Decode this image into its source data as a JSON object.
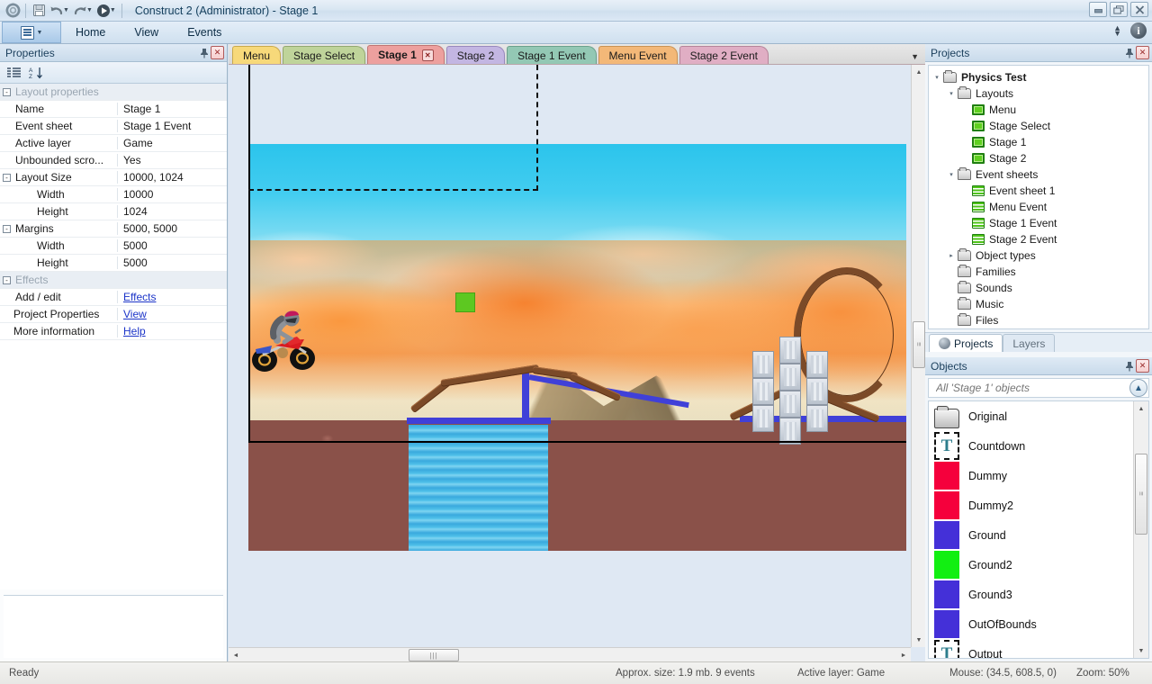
{
  "titlebar": {
    "app_icon": "construct-gear-icon",
    "title": "Construct 2 (Administrator) - Stage 1",
    "toolbar": [
      {
        "name": "save-button",
        "icon": "floppy-disk-icon"
      },
      {
        "name": "undo-button",
        "icon": "undo-arrow-icon"
      },
      {
        "name": "redo-button",
        "icon": "redo-arrow-icon"
      },
      {
        "name": "run-button",
        "icon": "play-circle-icon"
      },
      {
        "name": "quick-access-customize-button",
        "icon": "chevron-down-bar-icon"
      }
    ],
    "window_buttons": [
      {
        "name": "minimize-button",
        "glyph": "–"
      },
      {
        "name": "restore-button",
        "glyph": "❐"
      },
      {
        "name": "close-button",
        "glyph": "✕"
      }
    ]
  },
  "menubar": {
    "app_button_label": "",
    "items": [
      "Home",
      "View",
      "Events"
    ],
    "ribbon_toggle": "collapse-ribbon-icon",
    "help": "i"
  },
  "properties": {
    "panel_title": "Properties",
    "pin_glyph": "⚇",
    "close_glyph": "✕",
    "toolbar": [
      {
        "name": "categorized-view-button",
        "icon": "list-category-icon"
      },
      {
        "name": "alphabetical-sort-button",
        "icon": "sort-az-icon"
      }
    ],
    "rows": [
      {
        "type": "group",
        "expander": "-",
        "name": "Layout properties",
        "value": ""
      },
      {
        "type": "row",
        "expander": "",
        "name": "Name",
        "value": "Stage 1"
      },
      {
        "type": "row",
        "expander": "",
        "name": "Event sheet",
        "value": "Stage 1 Event"
      },
      {
        "type": "row",
        "expander": "",
        "name": "Active layer",
        "value": "Game"
      },
      {
        "type": "row",
        "expander": "",
        "name": "Unbounded scro...",
        "value": "Yes"
      },
      {
        "type": "row",
        "expander": "-",
        "name": "Layout Size",
        "value": "10000, 1024"
      },
      {
        "type": "sub",
        "expander": "",
        "name": "Width",
        "value": "10000"
      },
      {
        "type": "sub",
        "expander": "",
        "name": "Height",
        "value": "1024"
      },
      {
        "type": "row",
        "expander": "-",
        "name": "Margins",
        "value": "5000, 5000"
      },
      {
        "type": "sub",
        "expander": "",
        "name": "Width",
        "value": "5000"
      },
      {
        "type": "sub",
        "expander": "",
        "name": "Height",
        "value": "5000"
      },
      {
        "type": "group",
        "expander": "-",
        "name": "Effects",
        "value": ""
      },
      {
        "type": "row",
        "expander": "",
        "name": "Add / edit",
        "value": "Effects",
        "link": true
      },
      {
        "type": "rownoindent",
        "expander": "",
        "name": "Project Properties",
        "value": "View",
        "link": true
      },
      {
        "type": "rownoindent",
        "expander": "",
        "name": "More information",
        "value": "Help",
        "link": true
      }
    ]
  },
  "editor": {
    "tabs": [
      {
        "label": "Menu",
        "color": "#f7d97a",
        "border": "#c9a94b",
        "active": false,
        "closable": false
      },
      {
        "label": "Stage Select",
        "color": "#bfd49a",
        "border": "#92a870",
        "active": false,
        "closable": false
      },
      {
        "label": "Stage 1",
        "color": "#eda09e",
        "border": "#c07674",
        "active": true,
        "closable": true
      },
      {
        "label": "Stage 2",
        "color": "#c3b6e2",
        "border": "#9888bd",
        "active": false,
        "closable": false
      },
      {
        "label": "Stage 1 Event",
        "color": "#93c8b4",
        "border": "#6ba18c",
        "active": false,
        "closable": false
      },
      {
        "label": "Menu Event",
        "color": "#f3b878",
        "border": "#c99354",
        "active": false,
        "closable": false
      },
      {
        "label": "Stage 2 Event",
        "color": "#e0aec4",
        "border": "#b5849a",
        "active": false,
        "closable": false
      }
    ],
    "tab_dropdown_glyph": "▼",
    "close_glyph": "✕",
    "canvas": {
      "description": "Stage 1 layout - motocross physics scene",
      "objects": [
        {
          "name": "biker-sprite",
          "label": "Biker"
        },
        {
          "name": "green-square-object",
          "label": "Ground2",
          "color": "#5dc821"
        },
        {
          "name": "crate-stack",
          "label": "Crates"
        },
        {
          "name": "loop-track",
          "label": "Track loop"
        },
        {
          "name": "water-pool",
          "label": "Water"
        },
        {
          "name": "rock-ground",
          "label": "Ground"
        }
      ]
    },
    "scrollbars": {
      "left_arrow": "◄",
      "right_arrow": "►",
      "up_arrow": "▲",
      "down_arrow": "▼",
      "grip": "❘❘❘"
    }
  },
  "projects": {
    "panel_title": "Projects",
    "pin_glyph": "⚇",
    "close_glyph": "✕",
    "tree": [
      {
        "depth": 0,
        "twisty": "▾",
        "icon": "folder-icon",
        "label": "Physics Test",
        "bold": true
      },
      {
        "depth": 1,
        "twisty": "▾",
        "icon": "folder-icon",
        "label": "Layouts",
        "bold": false
      },
      {
        "depth": 2,
        "twisty": "",
        "icon": "layout-icon",
        "label": "Menu",
        "bold": false
      },
      {
        "depth": 2,
        "twisty": "",
        "icon": "layout-icon",
        "label": "Stage Select",
        "bold": false
      },
      {
        "depth": 2,
        "twisty": "",
        "icon": "layout-icon",
        "label": "Stage 1",
        "bold": false
      },
      {
        "depth": 2,
        "twisty": "",
        "icon": "layout-icon",
        "label": "Stage 2",
        "bold": false
      },
      {
        "depth": 1,
        "twisty": "▾",
        "icon": "folder-icon",
        "label": "Event sheets",
        "bold": false
      },
      {
        "depth": 2,
        "twisty": "",
        "icon": "sheet-icon",
        "label": "Event sheet 1",
        "bold": false
      },
      {
        "depth": 2,
        "twisty": "",
        "icon": "sheet-icon",
        "label": "Menu Event",
        "bold": false
      },
      {
        "depth": 2,
        "twisty": "",
        "icon": "sheet-icon",
        "label": "Stage 1 Event",
        "bold": false
      },
      {
        "depth": 2,
        "twisty": "",
        "icon": "sheet-icon",
        "label": "Stage 2 Event",
        "bold": false
      },
      {
        "depth": 1,
        "twisty": "▸",
        "icon": "folder-icon",
        "label": "Object types",
        "bold": false
      },
      {
        "depth": 1,
        "twisty": "",
        "icon": "folder-icon",
        "label": "Families",
        "bold": false
      },
      {
        "depth": 1,
        "twisty": "",
        "icon": "folder-icon",
        "label": "Sounds",
        "bold": false
      },
      {
        "depth": 1,
        "twisty": "",
        "icon": "folder-icon",
        "label": "Music",
        "bold": false
      },
      {
        "depth": 1,
        "twisty": "",
        "icon": "folder-icon",
        "label": "Files",
        "bold": false
      }
    ],
    "dock_tabs": [
      {
        "label": "Projects",
        "active": true
      },
      {
        "label": "Layers",
        "active": false
      }
    ]
  },
  "objects": {
    "panel_title": "Objects",
    "pin_glyph": "⚇",
    "close_glyph": "✕",
    "search_placeholder": "All 'Stage 1' objects",
    "search_value": "",
    "up_button_glyph": "▲",
    "items": [
      {
        "label": "Original",
        "thumb": "folder",
        "color": ""
      },
      {
        "label": "Countdown",
        "thumb": "text",
        "color": ""
      },
      {
        "label": "Dummy",
        "thumb": "swatch",
        "color": "#f5003c"
      },
      {
        "label": "Dummy2",
        "thumb": "swatch",
        "color": "#f5003c"
      },
      {
        "label": "Ground",
        "thumb": "swatch",
        "color": "#4430d8"
      },
      {
        "label": "Ground2",
        "thumb": "swatch",
        "color": "#12ef12"
      },
      {
        "label": "Ground3",
        "thumb": "swatch",
        "color": "#4430d8"
      },
      {
        "label": "OutOfBounds",
        "thumb": "swatch",
        "color": "#4430d8"
      },
      {
        "label": "Output",
        "thumb": "text",
        "color": ""
      }
    ]
  },
  "statusbar": {
    "ready": "Ready",
    "size": "Approx. size: 1.9 mb. 9 events",
    "active_layer": "Active layer: Game",
    "mouse": "Mouse: (34.5, 608.5, 0)",
    "zoom": "Zoom: 50%"
  }
}
